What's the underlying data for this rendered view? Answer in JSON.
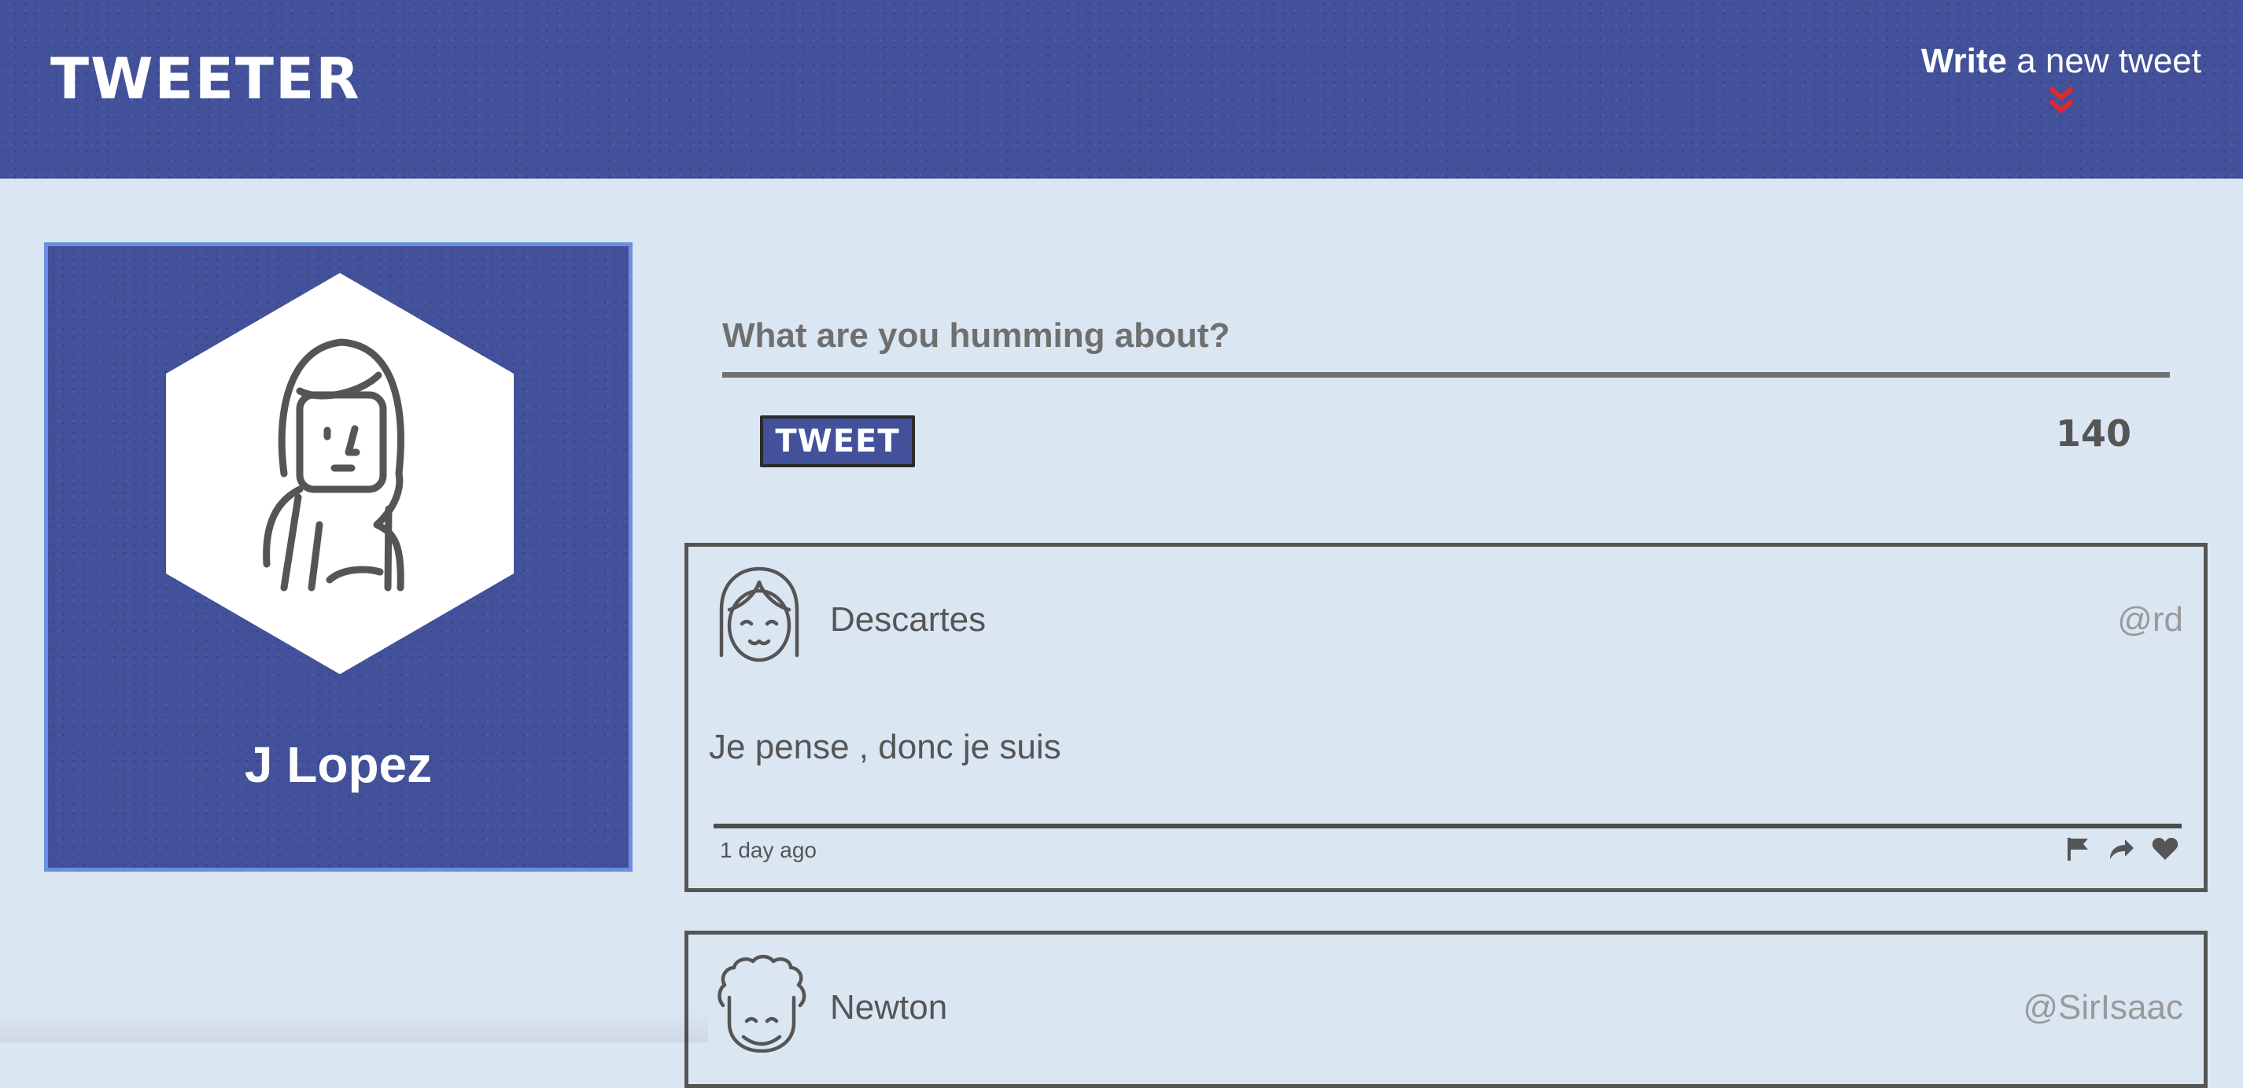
{
  "header": {
    "logo": "TWEETER",
    "compose_bold": "Write",
    "compose_rest": " a new tweet",
    "compose_icon": "double-chevron-down-icon",
    "accent_color": "#e0292e"
  },
  "profile": {
    "name": "J Lopez",
    "avatar_icon": "woman-avatar-icon"
  },
  "composer": {
    "placeholder": "What are you humming about?",
    "button_label": "TWEET",
    "char_count": "140"
  },
  "tweets": [
    {
      "name": "Descartes",
      "handle": "@rd",
      "body": "Je pense , donc je suis",
      "time": "1 day ago",
      "avatar_icon": "girl-bangs-avatar-icon"
    },
    {
      "name": "Newton",
      "handle": "@SirIsaac",
      "avatar_icon": "curly-hair-avatar-icon"
    }
  ],
  "actions": [
    "flag-icon",
    "retweet-icon",
    "heart-icon"
  ],
  "colors": {
    "brand": "#42519a",
    "background": "#dbe6f3",
    "text": "#555555"
  }
}
